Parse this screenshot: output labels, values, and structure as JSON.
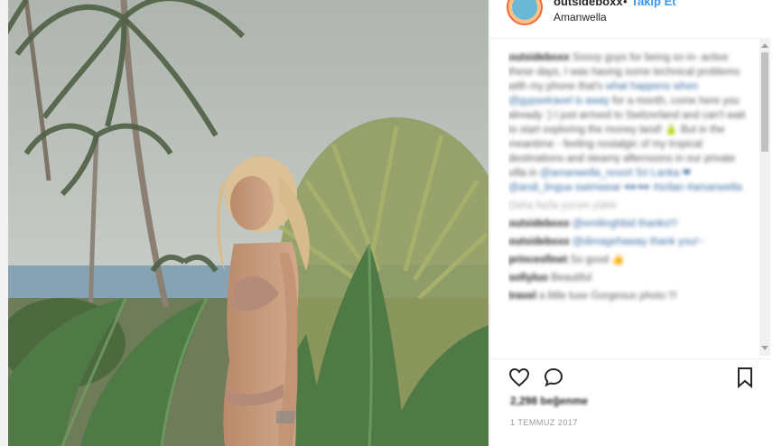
{
  "post": {
    "username": "outsideboxx",
    "separator": "•",
    "follow_label": "Takip Et",
    "location": "Amanwella",
    "likes": "2,298 beğenme",
    "date": "1 TEMMUZ 2017"
  },
  "caption": {
    "user": "outsideboxx",
    "lines": [
      "Soooy guys for being so in-",
      "active these days, I was having some",
      "technical problems with my phone that's",
      "what happens when @gypsetravel is away",
      "for a month, come here you already :) I",
      "just arrived to Switzerland and can't wait to",
      "start exploring the money land! 🍐",
      "But in the meantime - feeling nostalgic of",
      "my tropical destinations and steamy",
      "afternoons in our private villa in",
      "@amanwella_resort Sri Lanka ❤",
      "@andi_lingua swimwear 🕶🕶 #srilan",
      "#amanwella"
    ],
    "more_comments": "Daha fazla yorum yükle"
  },
  "comments": [
    {
      "user": "outsideboxx",
      "text": "@emilinghbid thanks!!!"
    },
    {
      "user": "outsideboxx",
      "text": "@dimagehaway thank you!~"
    },
    {
      "user": "princesfinet",
      "text": "So good 👍"
    },
    {
      "user": "sofiyluo",
      "text": "Beautiful"
    },
    {
      "user": "travel",
      "text": "a little luxe Gorgeous photo !!!"
    }
  ],
  "icons": {
    "heart": "heart-icon",
    "comment": "comment-icon",
    "save": "bookmark-icon"
  },
  "colors": {
    "follow": "#3897f0",
    "avatar_ring": "#f06a3a",
    "text": "#262626"
  }
}
